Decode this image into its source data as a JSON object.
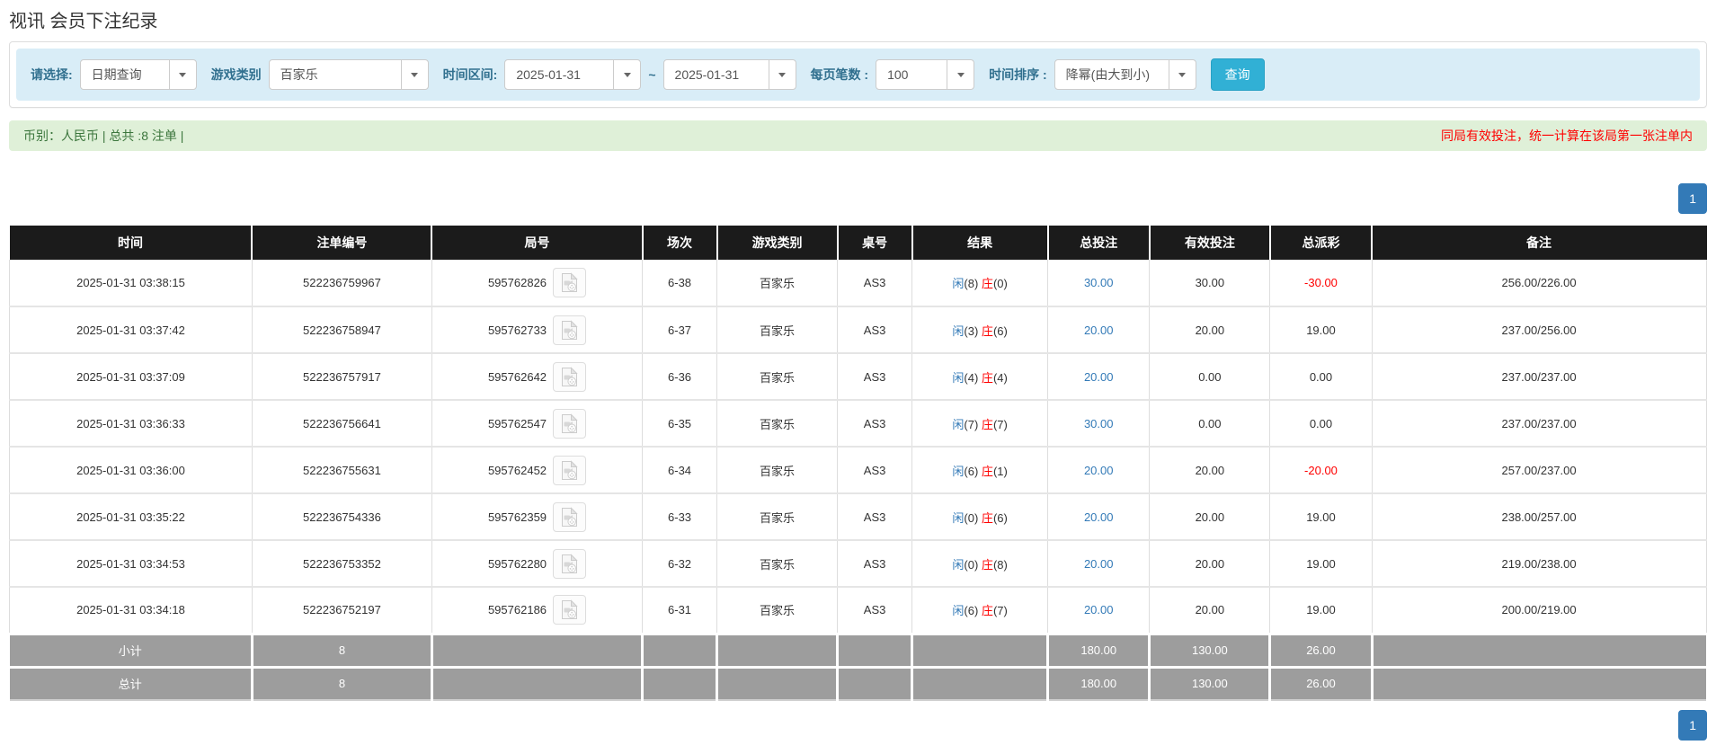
{
  "page": {
    "title": "视讯 会员下注纪录"
  },
  "filters": {
    "query_type_label": "请选择:",
    "query_type_value": "日期查询",
    "game_type_label": "游戏类别",
    "game_type_value": "百家乐",
    "time_range_label": "时间区间:",
    "date_from": "2025-01-31",
    "tilde": "~",
    "date_to": "2025-01-31",
    "page_size_label": "每页笔数 :",
    "page_size_value": "100",
    "sort_label": "时间排序 :",
    "sort_value": "降幂(由大到小)",
    "search_button": "查询"
  },
  "summary": {
    "left": "币别：人民币 | 总共 :8 注单 |",
    "right": "同局有效投注，统一计算在该局第一张注单内"
  },
  "pagination": {
    "page": "1"
  },
  "icons": {
    "video_icon": "video-file-icon",
    "dropdown_icon": "chevron-down-icon"
  },
  "colors": {
    "header_bg": "#1b1b1b",
    "footer_bg": "#9d9d9d",
    "accent_blue": "#337ab7",
    "negative_red": "#ff0000",
    "filter_bar_bg": "#d9edf7",
    "summary_bar_bg": "#dff0d8",
    "search_button_bg": "#31b0d5"
  },
  "table": {
    "headers": [
      "时间",
      "注单编号",
      "局号",
      "场次",
      "游戏类别",
      "桌号",
      "结果",
      "总投注",
      "有效投注",
      "总派彩",
      "备注"
    ],
    "rows": [
      {
        "time": "2025-01-31 03:38:15",
        "bet_id": "522236759967",
        "round_id": "595762826",
        "session": "6-38",
        "game": "百家乐",
        "table_no": "AS3",
        "player": "闲",
        "player_n": "(8)",
        "banker": "庄",
        "banker_n": "(0)",
        "total_bet": "30.00",
        "valid_bet": "30.00",
        "payout": "-30.00",
        "remark": "256.00/226.00"
      },
      {
        "time": "2025-01-31 03:37:42",
        "bet_id": "522236758947",
        "round_id": "595762733",
        "session": "6-37",
        "game": "百家乐",
        "table_no": "AS3",
        "player": "闲",
        "player_n": "(3)",
        "banker": "庄",
        "banker_n": "(6)",
        "total_bet": "20.00",
        "valid_bet": "20.00",
        "payout": "19.00",
        "remark": "237.00/256.00"
      },
      {
        "time": "2025-01-31 03:37:09",
        "bet_id": "522236757917",
        "round_id": "595762642",
        "session": "6-36",
        "game": "百家乐",
        "table_no": "AS3",
        "player": "闲",
        "player_n": "(4)",
        "banker": "庄",
        "banker_n": "(4)",
        "total_bet": "20.00",
        "valid_bet": "0.00",
        "payout": "0.00",
        "remark": "237.00/237.00"
      },
      {
        "time": "2025-01-31 03:36:33",
        "bet_id": "522236756641",
        "round_id": "595762547",
        "session": "6-35",
        "game": "百家乐",
        "table_no": "AS3",
        "player": "闲",
        "player_n": "(7)",
        "banker": "庄",
        "banker_n": "(7)",
        "total_bet": "30.00",
        "valid_bet": "0.00",
        "payout": "0.00",
        "remark": "237.00/237.00"
      },
      {
        "time": "2025-01-31 03:36:00",
        "bet_id": "522236755631",
        "round_id": "595762452",
        "session": "6-34",
        "game": "百家乐",
        "table_no": "AS3",
        "player": "闲",
        "player_n": "(6)",
        "banker": "庄",
        "banker_n": "(1)",
        "total_bet": "20.00",
        "valid_bet": "20.00",
        "payout": "-20.00",
        "remark": "257.00/237.00"
      },
      {
        "time": "2025-01-31 03:35:22",
        "bet_id": "522236754336",
        "round_id": "595762359",
        "session": "6-33",
        "game": "百家乐",
        "table_no": "AS3",
        "player": "闲",
        "player_n": "(0)",
        "banker": "庄",
        "banker_n": "(6)",
        "total_bet": "20.00",
        "valid_bet": "20.00",
        "payout": "19.00",
        "remark": "238.00/257.00"
      },
      {
        "time": "2025-01-31 03:34:53",
        "bet_id": "522236753352",
        "round_id": "595762280",
        "session": "6-32",
        "game": "百家乐",
        "table_no": "AS3",
        "player": "闲",
        "player_n": "(0)",
        "banker": "庄",
        "banker_n": "(8)",
        "total_bet": "20.00",
        "valid_bet": "20.00",
        "payout": "19.00",
        "remark": "219.00/238.00"
      },
      {
        "time": "2025-01-31 03:34:18",
        "bet_id": "522236752197",
        "round_id": "595762186",
        "session": "6-31",
        "game": "百家乐",
        "table_no": "AS3",
        "player": "闲",
        "player_n": "(6)",
        "banker": "庄",
        "banker_n": "(7)",
        "total_bet": "20.00",
        "valid_bet": "20.00",
        "payout": "19.00",
        "remark": "200.00/219.00"
      }
    ],
    "subtotal": {
      "label": "小计",
      "count": "8",
      "total_bet": "180.00",
      "valid_bet": "130.00",
      "payout": "26.00"
    },
    "total": {
      "label": "总计",
      "count": "8",
      "total_bet": "180.00",
      "valid_bet": "130.00",
      "payout": "26.00"
    }
  }
}
